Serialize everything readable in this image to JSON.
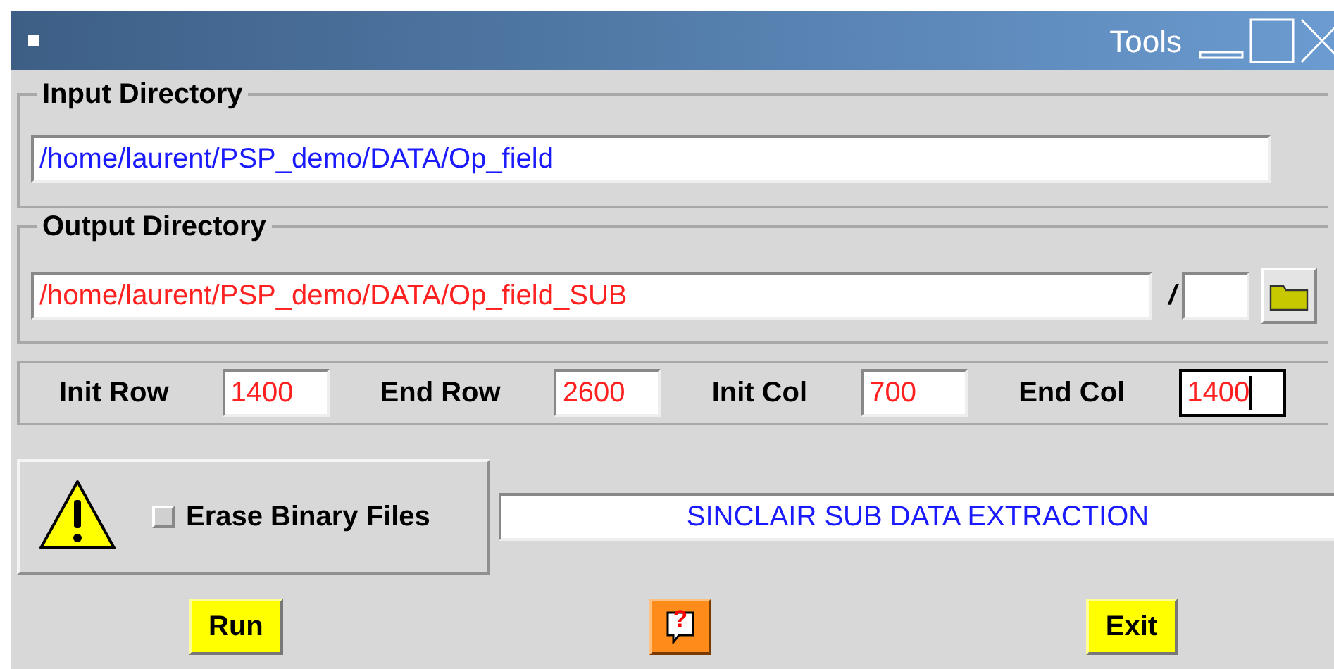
{
  "window": {
    "title": "Tools"
  },
  "input_directory": {
    "legend": "Input Directory",
    "value": "/home/laurent/PSP_demo/DATA/Op_field"
  },
  "output_directory": {
    "legend": "Output Directory",
    "value": "/home/laurent/PSP_demo/DATA/Op_field_SUB",
    "separator": "/"
  },
  "range_fields": [
    {
      "label": "Init Row",
      "value": "1400",
      "focused": false
    },
    {
      "label": "End Row",
      "value": "2600",
      "focused": false
    },
    {
      "label": "Init Col",
      "value": "700",
      "focused": false
    },
    {
      "label": "End Col",
      "value": "1400",
      "focused": true
    }
  ],
  "erase_binary_files": {
    "label": "Erase Binary Files",
    "checked": false
  },
  "status_text": "SINCLAIR SUB DATA EXTRACTION",
  "buttons": [
    {
      "kind": "text",
      "label": "Run"
    },
    {
      "kind": "help",
      "label": "?"
    },
    {
      "kind": "text",
      "label": "Exit"
    }
  ]
}
